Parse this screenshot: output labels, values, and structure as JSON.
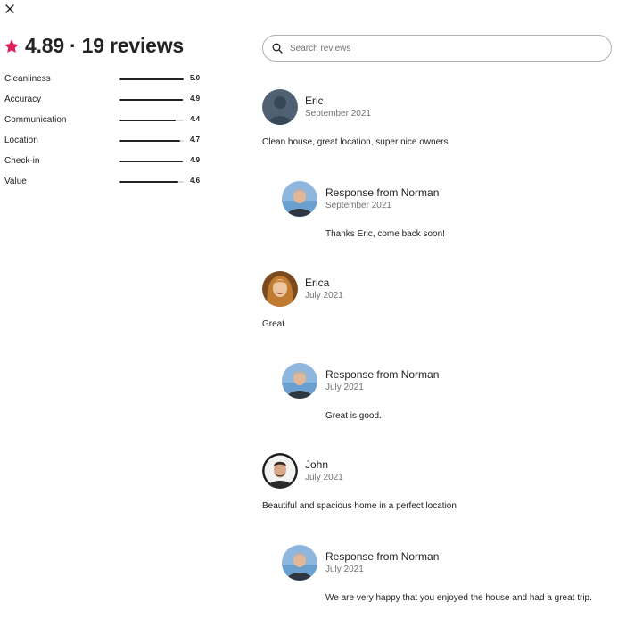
{
  "close": {
    "icon": "close-icon"
  },
  "summary": {
    "star_icon": "star-icon",
    "star_color": "#e01e5a",
    "rating": "4.89",
    "separator": "·",
    "count": "19 reviews"
  },
  "categories": [
    {
      "label": "Cleanliness",
      "value": "5.0",
      "score": 5.0
    },
    {
      "label": "Accuracy",
      "value": "4.9",
      "score": 4.9
    },
    {
      "label": "Communication",
      "value": "4.4",
      "score": 4.4
    },
    {
      "label": "Location",
      "value": "4.7",
      "score": 4.7
    },
    {
      "label": "Check-in",
      "value": "4.9",
      "score": 4.9
    },
    {
      "label": "Value",
      "value": "4.6",
      "score": 4.6
    }
  ],
  "category_max_score": 5,
  "search": {
    "icon": "search-icon",
    "placeholder": "Search reviews"
  },
  "reviews": [
    {
      "name": "Eric",
      "date": "September 2021",
      "text": "Clean house, great location, super nice owners",
      "response": {
        "title": "Response from Norman",
        "date": "September 2021",
        "text": "Thanks Eric, come back soon!"
      }
    },
    {
      "name": "Erica",
      "date": "July 2021",
      "text": "Great",
      "response": {
        "title": "Response from Norman",
        "date": "July 2021",
        "text": "Great is good."
      }
    },
    {
      "name": "John",
      "date": "July 2021",
      "text": "Beautiful and spacious home in a perfect location",
      "response": {
        "title": "Response from Norman",
        "date": "July 2021",
        "text": "We are very happy that you enjoyed the house and had a great trip."
      }
    }
  ]
}
